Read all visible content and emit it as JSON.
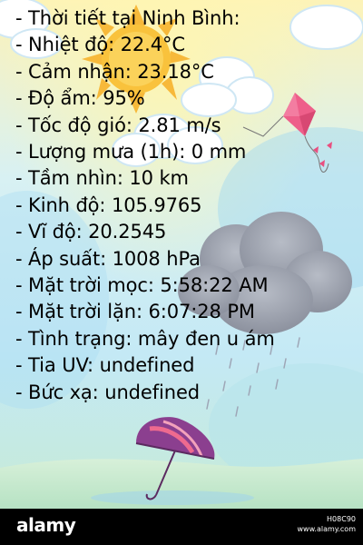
{
  "weather": {
    "lines": [
      "- Thời tiết tại Ninh Bình:",
      "- Nhiệt độ: 22.4°C",
      "- Cảm nhận: 23.18°C",
      "- Độ ẩm: 95%",
      "- Tốc độ gió: 2.81 m/s",
      "- Lượng mưa (1h): 0 mm",
      "- Tầm nhìn: 10 km",
      "- Kinh độ: 105.9765",
      "- Vĩ độ: 20.2545",
      "- Áp suất: 1008 hPa",
      "- Mặt trời mọc: 5:58:22 AM",
      "- Mặt trời lặn: 6:07:28 PM",
      "- Tình trạng: mây đen u ám",
      "- Tia UV: undefined",
      "- Bức xạ: undefined"
    ]
  },
  "footer": {
    "logo": "alamy",
    "image_id": "H08C90",
    "site": "www.alamy.com"
  },
  "colors": {
    "sky_top": "#fdf3b8",
    "sky_mid": "#c9ecf6",
    "sky_bottom": "#bfe7d8",
    "sun": "#f9c23c",
    "kite": "#ee5f8a",
    "umbrella": "#8b3f8f",
    "rain_cloud": "#9aa0ad"
  },
  "icons": [
    "sun-icon",
    "kite-icon",
    "cloud-icon",
    "rain-cloud-icon",
    "umbrella-icon"
  ]
}
